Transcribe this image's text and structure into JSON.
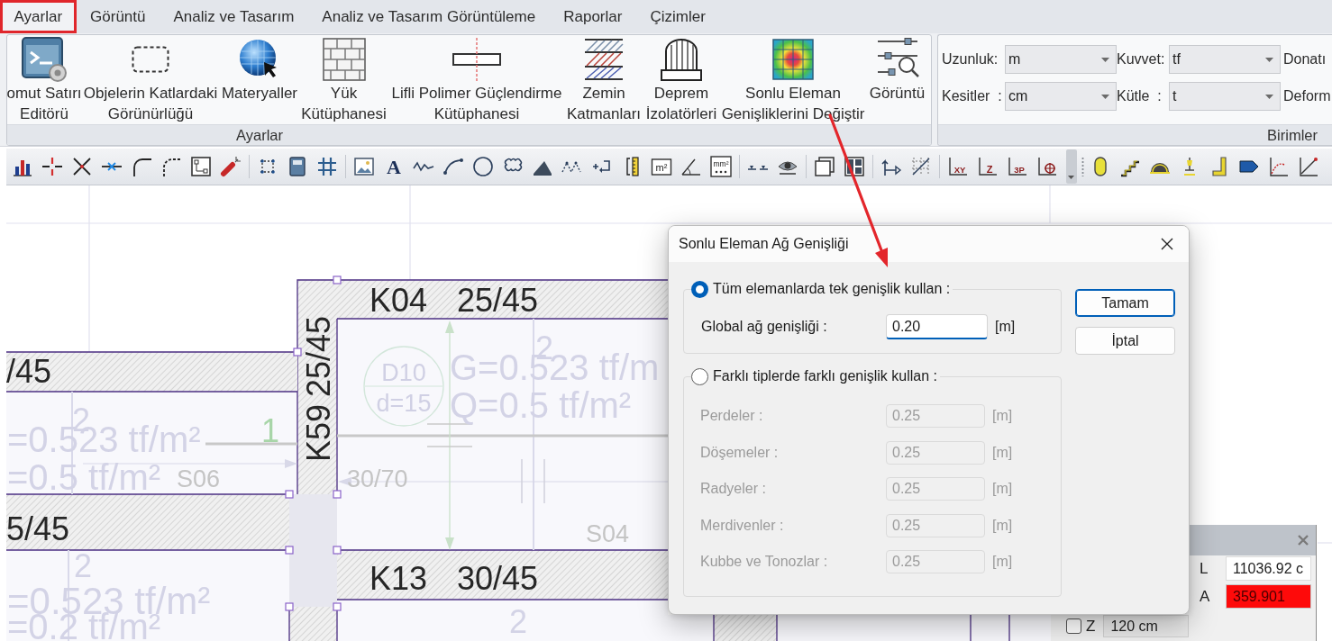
{
  "menu_tabs": [
    {
      "label": "Ayarlar",
      "selected": true,
      "highlighted": true
    },
    {
      "label": "Görüntü",
      "selected": false,
      "highlighted": false
    },
    {
      "label": "Analiz ve Tasarım",
      "selected": false,
      "highlighted": false
    },
    {
      "label": "Analiz ve Tasarım Görüntüleme",
      "selected": false,
      "highlighted": false
    },
    {
      "label": "Raporlar",
      "selected": false,
      "highlighted": false
    },
    {
      "label": "Çizimler",
      "selected": false,
      "highlighted": false
    }
  ],
  "ribbon": {
    "settings_group": {
      "title": "Ayarlar",
      "buttons": [
        {
          "lines": [
            "omut Satırı",
            "Editörü"
          ]
        },
        {
          "lines": [
            "Objelerin Katlardaki",
            "Görünürlüğü"
          ]
        },
        {
          "lines": [
            "Materyaller"
          ]
        },
        {
          "lines": [
            "Yük",
            "Kütüphanesi"
          ]
        },
        {
          "lines": [
            "Lifli Polimer Güçlendirme",
            "Kütüphanesi"
          ]
        },
        {
          "lines": [
            "Zemin",
            "Katmanları"
          ]
        },
        {
          "lines": [
            "Deprem",
            "İzolatörleri"
          ]
        },
        {
          "lines": [
            "Sonlu Eleman",
            "Genişliklerini Değiştir"
          ]
        },
        {
          "lines": [
            "Görüntü"
          ]
        }
      ]
    },
    "units_group": {
      "title": "Birimler",
      "rows": [
        [
          {
            "label": "Uzunluk:",
            "value": "m"
          },
          {
            "label": "Kuvvet:",
            "value": "tf"
          },
          {
            "label": "Donatı"
          }
        ],
        [
          {
            "label": "Kesitler  :",
            "value": "cm"
          },
          {
            "label": "Kütle  :",
            "value": "t"
          },
          {
            "label": "Deform"
          }
        ]
      ]
    }
  },
  "toolbar": {
    "icon_texts": [
      "A",
      "m²",
      "mm²",
      "XY",
      "Z",
      "3P"
    ]
  },
  "drawing": {
    "beams": [
      {
        "code": "K04",
        "section": "25/45"
      },
      {
        "code": "K59",
        "section": "25/45"
      },
      {
        "section": "/45"
      },
      {
        "section": "5/45"
      },
      {
        "code": "K13",
        "section": "30/45"
      }
    ],
    "slab_loads": [
      "G=0.523 tf/m",
      "Q=0.5 tf/m²",
      "=0.523 tf/m²",
      "=0.5 tf/m²",
      "=0.523 tf/m²",
      "=0.2 tf/m²"
    ],
    "slab_names": [
      "S06",
      "S04"
    ],
    "dimension_labels": [
      "30/70"
    ],
    "thickness_symbol": {
      "name": "D10",
      "depth": "d=15"
    },
    "direction_marks": [
      {
        "text": "2",
        "color": "#d3d3e6"
      },
      {
        "text": "1",
        "color": "#a8d5a8"
      },
      {
        "text": "2",
        "color": "#d3d3e6"
      },
      {
        "text": "2",
        "color": "#d3d3e6"
      },
      {
        "text": "2",
        "color": "#d3d3e6"
      }
    ]
  },
  "dialog": {
    "title": "Sonlu Eleman Ağ Genişliği",
    "options": [
      {
        "label": "Tüm elemanlarda tek genişlik kullan :",
        "selected": true,
        "fields": [
          {
            "label": "Global ağ genişliği :",
            "value": "0.20",
            "unit": "[m]",
            "focused": true,
            "disabled": false
          }
        ]
      },
      {
        "label": "Farklı tiplerde farklı genişlik kullan :",
        "selected": false,
        "fields": [
          {
            "label": "Perdeler :",
            "value": "0.25",
            "unit": "[m]",
            "focused": false,
            "disabled": true
          },
          {
            "label": "Döşemeler :",
            "value": "0.25",
            "unit": "[m]",
            "focused": false,
            "disabled": true
          },
          {
            "label": "Radyeler :",
            "value": "0.25",
            "unit": "[m]",
            "focused": false,
            "disabled": true
          },
          {
            "label": "Merdivenler :",
            "value": "0.25",
            "unit": "[m]",
            "focused": false,
            "disabled": true
          },
          {
            "label": "Kubbe ve Tonozlar :",
            "value": "0.25",
            "unit": "[m]",
            "focused": false,
            "disabled": true
          }
        ]
      }
    ],
    "buttons": [
      {
        "label": "Tamam",
        "default": true
      },
      {
        "label": "İptal",
        "default": false
      }
    ]
  },
  "measure_panel": {
    "values": [
      {
        "label": "L",
        "value": "11036.92 c",
        "alert": false
      },
      {
        "label": "A",
        "value": "359.901",
        "alert": true
      }
    ],
    "z_filter": {
      "label": "Z",
      "checked": false,
      "value": "120 cm"
    }
  }
}
